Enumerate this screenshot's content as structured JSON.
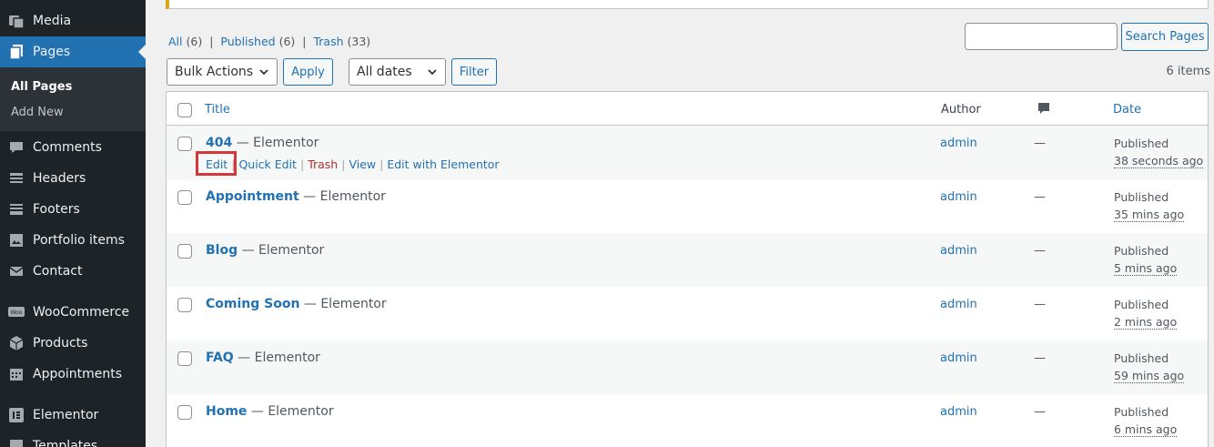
{
  "sidebar": {
    "items": [
      {
        "label": "Media",
        "icon": "media-icon"
      },
      {
        "label": "Pages",
        "icon": "pages-icon"
      },
      {
        "label": "Comments",
        "icon": "comments-icon"
      },
      {
        "label": "Headers",
        "icon": "headers-icon"
      },
      {
        "label": "Footers",
        "icon": "footers-icon"
      },
      {
        "label": "Portfolio items",
        "icon": "portfolio-icon"
      },
      {
        "label": "Contact",
        "icon": "envelope-icon"
      },
      {
        "label": "WooCommerce",
        "icon": "woocommerce-icon"
      },
      {
        "label": "Products",
        "icon": "products-icon"
      },
      {
        "label": "Appointments",
        "icon": "calendar-icon"
      },
      {
        "label": "Elementor",
        "icon": "elementor-icon"
      },
      {
        "label": "Templates",
        "icon": "templates-icon"
      }
    ],
    "submenu": {
      "all_pages": "All Pages",
      "add_new": "Add New"
    }
  },
  "filters": {
    "all": "All",
    "all_count": "(6)",
    "published": "Published",
    "published_count": "(6)",
    "trash": "Trash",
    "trash_count": "(33)",
    "separator": "|"
  },
  "toolbar": {
    "bulk_actions": "Bulk Actions",
    "apply": "Apply",
    "dates": "All dates",
    "filter": "Filter",
    "search_button": "Search Pages",
    "search_value": "",
    "items_count": "6 items"
  },
  "table": {
    "headers": {
      "title": "Title",
      "author": "Author",
      "comments_icon": "comment-bubble-icon",
      "date": "Date"
    },
    "rows": [
      {
        "title": "404",
        "state": "— Elementor",
        "author": "admin",
        "comments": "—",
        "status": "Published",
        "time": "38 seconds ago"
      },
      {
        "title": "Appointment",
        "state": "— Elementor",
        "author": "admin",
        "comments": "—",
        "status": "Published",
        "time": "35 mins ago"
      },
      {
        "title": "Blog",
        "state": "— Elementor",
        "author": "admin",
        "comments": "—",
        "status": "Published",
        "time": "5 mins ago"
      },
      {
        "title": "Coming Soon",
        "state": "— Elementor",
        "author": "admin",
        "comments": "—",
        "status": "Published",
        "time": "2 mins ago"
      },
      {
        "title": "FAQ",
        "state": "— Elementor",
        "author": "admin",
        "comments": "—",
        "status": "Published",
        "time": "59 mins ago"
      },
      {
        "title": "Home",
        "state": "— Elementor",
        "author": "admin",
        "comments": "—",
        "status": "Published",
        "time": "6 mins ago"
      }
    ],
    "row_actions": {
      "edit": "Edit",
      "quick_edit": "Quick Edit",
      "trash": "Trash",
      "view": "View",
      "edit_elementor": "Edit with Elementor",
      "separator": "|"
    }
  },
  "colors": {
    "accent": "#2271b1",
    "sidebar_bg": "#1d2327",
    "highlight": "#d63638",
    "trash": "#b32d2e"
  }
}
